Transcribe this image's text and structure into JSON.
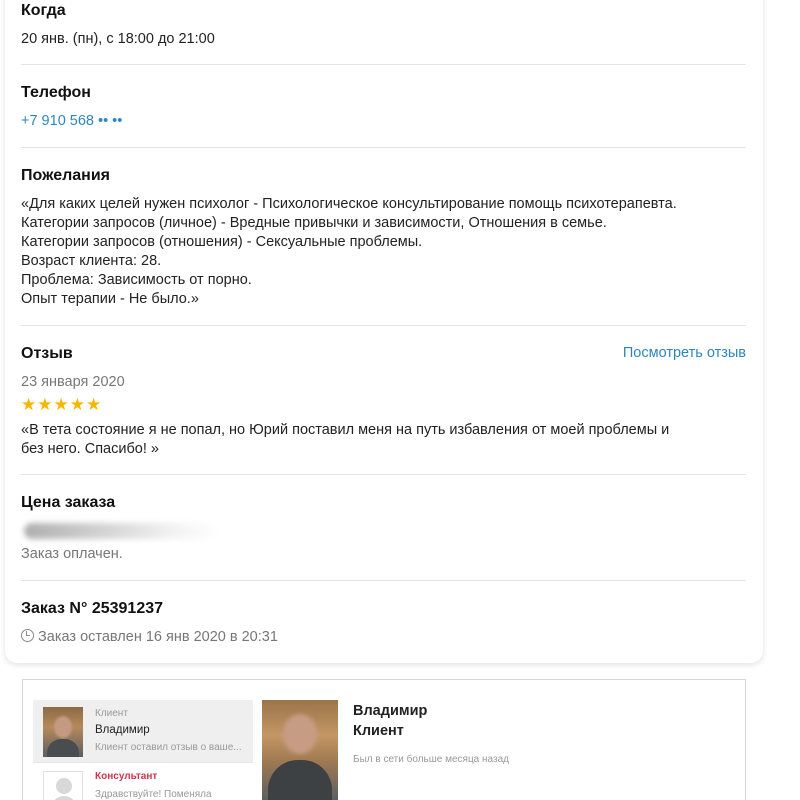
{
  "when": {
    "heading": "Когда",
    "value": "20 янв. (пн), с 18:00 до 21:00"
  },
  "phone": {
    "heading": "Телефон",
    "value": "+7 910 568 •• ••"
  },
  "wishes": {
    "heading": "Пожелания",
    "lines": [
      "«Для каких целей нужен психолог - Психологическое консультирование помощь психотерапевта.",
      "Категории запросов (личное) - Вредные привычки и зависимости, Отношения в семье.",
      "Категории запросов (отношения) - Сексуальные проблемы.",
      "Возраст клиента: 28.",
      "Проблема: Зависимость от порно.",
      "Опыт терапии - Не было.»"
    ]
  },
  "review": {
    "heading": "Отзыв",
    "view_link": "Посмотреть отзыв",
    "date": "23 января 2020",
    "rating": 5,
    "stars": "★★★★★",
    "text_line1": "«В тета состояние я не попал, но Юрий поставил меня на путь избавления от моей проблемы и",
    "text_line2": "без него. Спасибо! »"
  },
  "price": {
    "heading": "Цена заказа",
    "status": "Заказ оплачен."
  },
  "order": {
    "heading": "Заказ N° 25391237",
    "placed": "Заказ оставлен 16 янв 2020 в 20:31",
    "icon": "clock-icon"
  },
  "chat": {
    "items": [
      {
        "role": "Клиент",
        "name": "Владимир",
        "message": "Клиент оставил отзыв о ваше..."
      },
      {
        "role": "Консультант",
        "message": "Здравствуйте! Поменяла"
      }
    ]
  },
  "profile": {
    "name": "Владимир",
    "role": "Клиент",
    "status": "Был в сети больше месяца назад"
  },
  "colors": {
    "link": "#2e86c1",
    "star": "#f5b700",
    "consultant": "#d0344a"
  }
}
